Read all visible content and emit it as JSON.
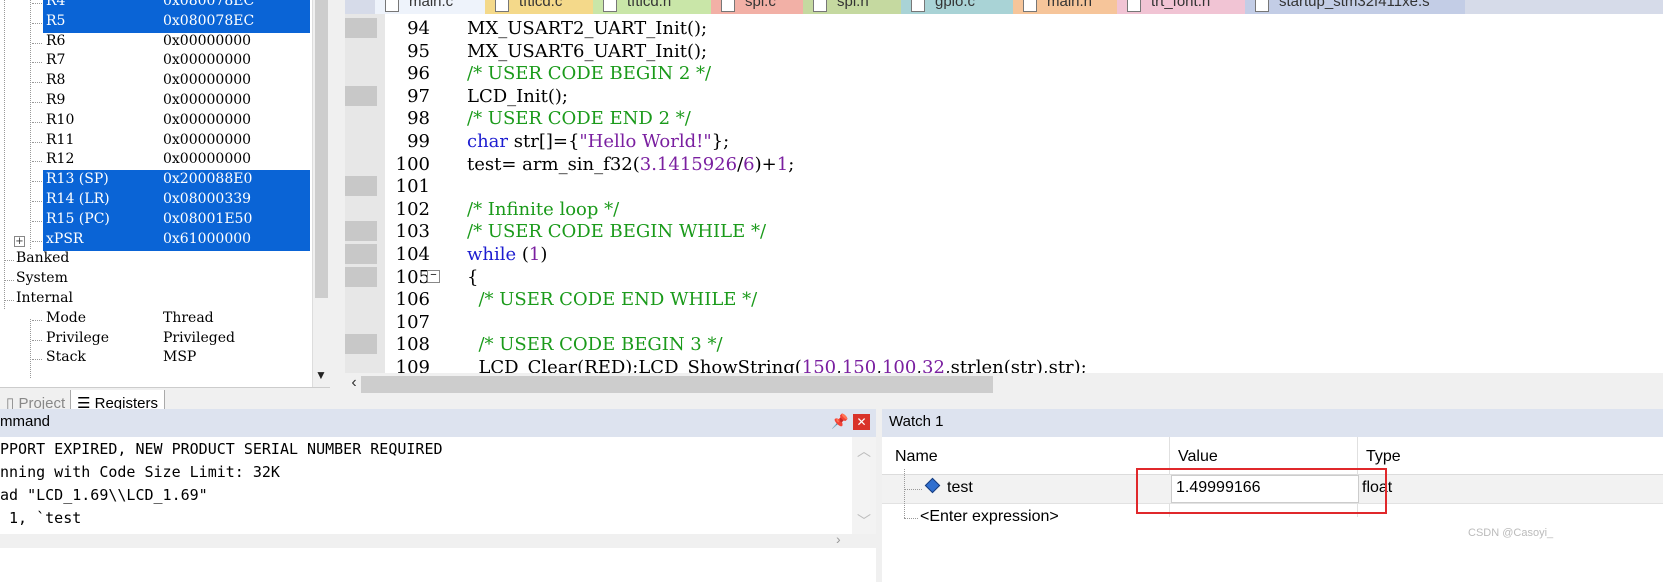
{
  "registers": [
    {
      "name": "R4",
      "value": "0x080078EC",
      "selected": true
    },
    {
      "name": "R5",
      "value": "0x080078EC",
      "selected": true
    },
    {
      "name": "R6",
      "value": "0x00000000",
      "selected": false
    },
    {
      "name": "R7",
      "value": "0x00000000",
      "selected": false
    },
    {
      "name": "R8",
      "value": "0x00000000",
      "selected": false
    },
    {
      "name": "R9",
      "value": "0x00000000",
      "selected": false
    },
    {
      "name": "R10",
      "value": "0x00000000",
      "selected": false
    },
    {
      "name": "R11",
      "value": "0x00000000",
      "selected": false
    },
    {
      "name": "R12",
      "value": "0x00000000",
      "selected": false
    },
    {
      "name": "R13 (SP)",
      "value": "0x200088E0",
      "selected": true
    },
    {
      "name": "R14 (LR)",
      "value": "0x08000339",
      "selected": true
    },
    {
      "name": "R15 (PC)",
      "value": "0x08001E50",
      "selected": true
    },
    {
      "name": "xPSR",
      "value": "0x61000000",
      "selected": true
    }
  ],
  "groups": [
    "Banked",
    "System",
    "Internal"
  ],
  "internal": [
    {
      "name": "Mode",
      "value": "Thread"
    },
    {
      "name": "Privilege",
      "value": "Privileged"
    },
    {
      "name": "Stack",
      "value": "MSP"
    }
  ],
  "panel_tabs": {
    "project": "Project",
    "registers": "Registers"
  },
  "editor_tabs": [
    {
      "label": "main.c",
      "color": "#eef3fb"
    },
    {
      "label": "tftlcd.c",
      "color": "#f4d98a"
    },
    {
      "label": "tftlcd.h",
      "color": "#c9e6a8"
    },
    {
      "label": "spi.c",
      "color": "#f2b0a6"
    },
    {
      "label": "spi.h",
      "color": "#c5d9a0"
    },
    {
      "label": "gpio.c",
      "color": "#a9d3d6"
    },
    {
      "label": "main.h",
      "color": "#f6c59a"
    },
    {
      "label": "trt_font.h",
      "color": "#f1c4d4"
    },
    {
      "label": "startup_stm32f411xe.s",
      "color": "#c3cde6"
    }
  ],
  "code": [
    {
      "n": "94",
      "t": "MX_USART2_UART_Init();"
    },
    {
      "n": "95",
      "t": "MX_USART6_UART_Init();"
    },
    {
      "n": "96",
      "t": "/* USER CODE BEGIN 2 */"
    },
    {
      "n": "97",
      "t": "LCD_Init();"
    },
    {
      "n": "98",
      "t": "/* USER CODE END 2 */"
    },
    {
      "n": "99",
      "t": "char str[]={\"Hello World!\"};"
    },
    {
      "n": "100",
      "t": "test= arm_sin_f32(3.1415926/6)+1;"
    },
    {
      "n": "101",
      "t": ""
    },
    {
      "n": "102",
      "t": "/* Infinite loop */"
    },
    {
      "n": "103",
      "t": "/* USER CODE BEGIN WHILE */"
    },
    {
      "n": "104",
      "t": "while (1)"
    },
    {
      "n": "105",
      "t": "{"
    },
    {
      "n": "106",
      "t": "  /* USER CODE END WHILE */"
    },
    {
      "n": "107",
      "t": ""
    },
    {
      "n": "108",
      "t": "  /* USER CODE BEGIN 3 */"
    },
    {
      "n": "109",
      "t": "  LCD_Clear(RED);LCD_ShowString(150,150,100,32,strlen(str),str);"
    }
  ],
  "command": {
    "title": "mmand",
    "lines": [
      "PPORT EXPIRED, NEW PRODUCT SERIAL NUMBER REQUIRED",
      "nning with Code Size Limit: 32K",
      "ad \"LCD_1.69\\\\LCD_1.69\"",
      " 1, `test"
    ]
  },
  "watch": {
    "title": "Watch 1",
    "columns": {
      "name": "Name",
      "value": "Value",
      "type": "Type"
    },
    "rows": [
      {
        "name": "test",
        "value": "1.49999166",
        "type": "float"
      }
    ],
    "enter_expression": "<Enter expression>"
  },
  "watermark": "CSDN @Casoyi_",
  "colors": {
    "selection": "#0a64d6",
    "comment": "#1a9a1a",
    "keyword": "#1c1cd0",
    "highlight_box": "#e0282b"
  }
}
